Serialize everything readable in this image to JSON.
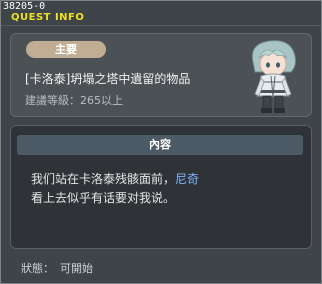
{
  "window": {
    "quest_id": "38205-0",
    "title": "QUEST INFO"
  },
  "quest": {
    "badge": "主要",
    "name": "[卡洛泰]坍塌之塔中遺留的物品",
    "required_level": "建議等級：265以上",
    "npc_portrait": "white-haired-npc-icon"
  },
  "content": {
    "header": "內容",
    "line1_prefix": "我们站在卡洛泰残骸面前，",
    "npc_name": "尼奇",
    "line2": "看上去似乎有话要对我说。"
  },
  "status": {
    "label": "狀態：",
    "value": "可開始"
  },
  "colors": {
    "title": "#f0e020",
    "badge": "#c0ad93",
    "npc_name": "#7fb3ff"
  }
}
